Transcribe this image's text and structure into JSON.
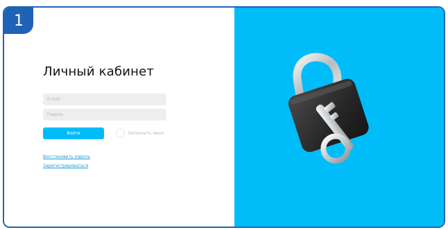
{
  "step": {
    "number": "1"
  },
  "login": {
    "title": "Личный кабинет",
    "email_placeholder": "E-mail",
    "password_placeholder": "Пароль",
    "login_button": "Войти",
    "remember_label": "Запомнить меня",
    "restore_link": "Восстановить пароль",
    "register_link": "Зарегистрироваться"
  },
  "illustration": {
    "icon": "padlock-with-key-icon"
  },
  "colors": {
    "accent": "#00bdf9",
    "frame": "#1e63b6",
    "field_bg": "#eeeeee",
    "link": "#1c9ad8"
  }
}
